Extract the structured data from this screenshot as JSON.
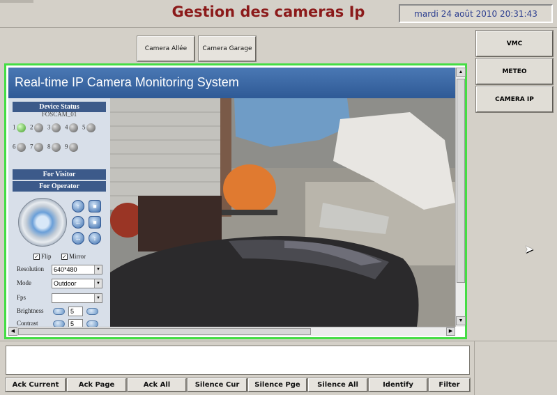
{
  "header": {
    "title": "Gestion des cameras Ip",
    "datetime": "mardi 24 août 2010 20:31:43"
  },
  "camera_selector": {
    "buttons": [
      "Camera Allée",
      "Camera Garage"
    ]
  },
  "nav": {
    "items": [
      "VMC",
      "METEO",
      "CAMERA IP"
    ]
  },
  "camera_page": {
    "title": "Real-time IP Camera Monitoring System",
    "device_status_label": "Device Status",
    "device_name": "FOSCAM_01",
    "channels": [
      "1",
      "2",
      "3",
      "4",
      "5",
      "6",
      "7",
      "8",
      "9"
    ],
    "active_channel": "1",
    "for_visitor_label": "For Visitor",
    "for_operator_label": "For Operator",
    "flip_label": "Flip",
    "flip_checked": true,
    "mirror_label": "Mirror",
    "mirror_checked": true,
    "resolution_label": "Resolution",
    "resolution_value": "640*480",
    "mode_label": "Mode",
    "mode_value": "Outdoor",
    "fps_label": "Fps",
    "fps_value": "",
    "brightness_label": "Brightness",
    "brightness_value": "5",
    "contrast_label": "Contrast",
    "contrast_value": "5"
  },
  "alarm_bar": {
    "buttons": [
      "Ack Current",
      "Ack Page",
      "Ack All",
      "Silence Cur",
      "Silence Pge",
      "Silence All",
      "Identify",
      "Filter"
    ]
  },
  "colors": {
    "title_red": "#8b1a1a",
    "clock_blue": "#2b3d8f",
    "frame_green": "#44dd44",
    "header_blue": "#2f5a96"
  }
}
